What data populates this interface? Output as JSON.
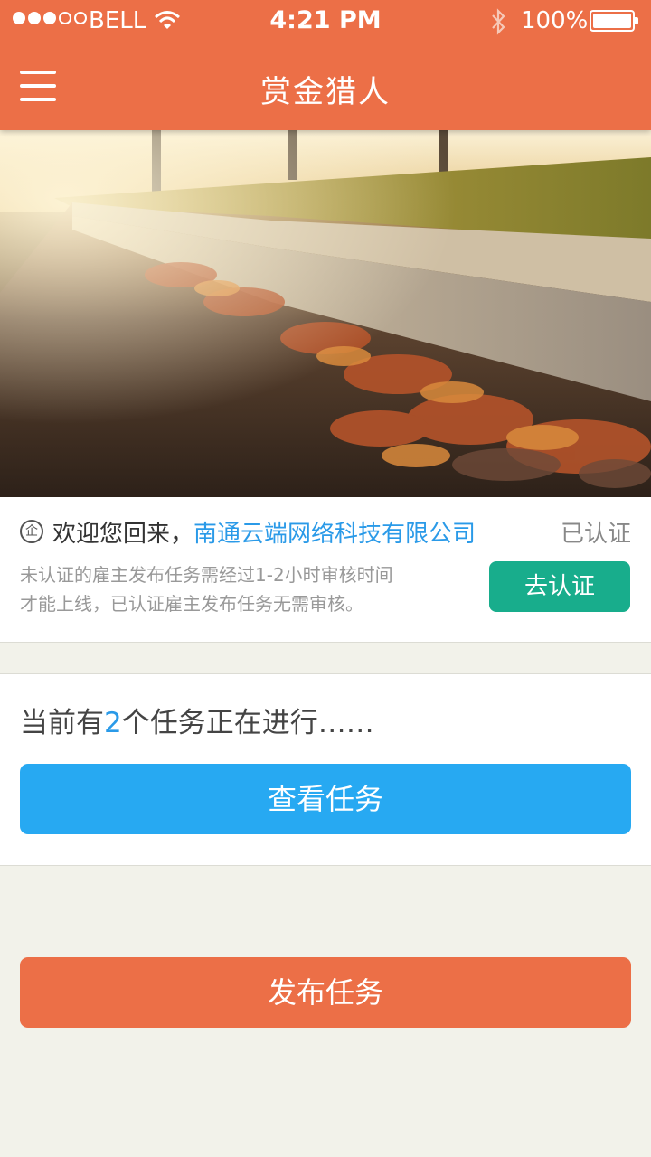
{
  "status_bar": {
    "carrier": "BELL",
    "time": "4:21 PM",
    "battery": "100%",
    "signal_bars_filled": 3,
    "signal_bars_total": 5
  },
  "header": {
    "title": "赏金猎人",
    "menu_icon": "hamburger-menu-icon"
  },
  "hero": {
    "icon": "autumn-leaves-street-photo"
  },
  "welcome": {
    "company_icon_glyph": "企",
    "greeting": "欢迎您回来，",
    "company_name": "南通云端网络科技有限公司",
    "status": "已认证",
    "notice_line1": "未认证的雇主发布任务需经过1-2小时审核时间",
    "notice_line2": "才能上线，已认证雇主发布任务无需审核。",
    "verify_button": "去认证"
  },
  "tasks": {
    "prefix": "当前有",
    "count": "2",
    "suffix": "个任务正在进行……",
    "view_button": "查看任务"
  },
  "actions": {
    "publish_button": "发布任务"
  },
  "colors": {
    "primary": "#ec6f47",
    "blue": "#27a9f2",
    "green": "#18ad8c",
    "background": "#f2f2ea"
  }
}
